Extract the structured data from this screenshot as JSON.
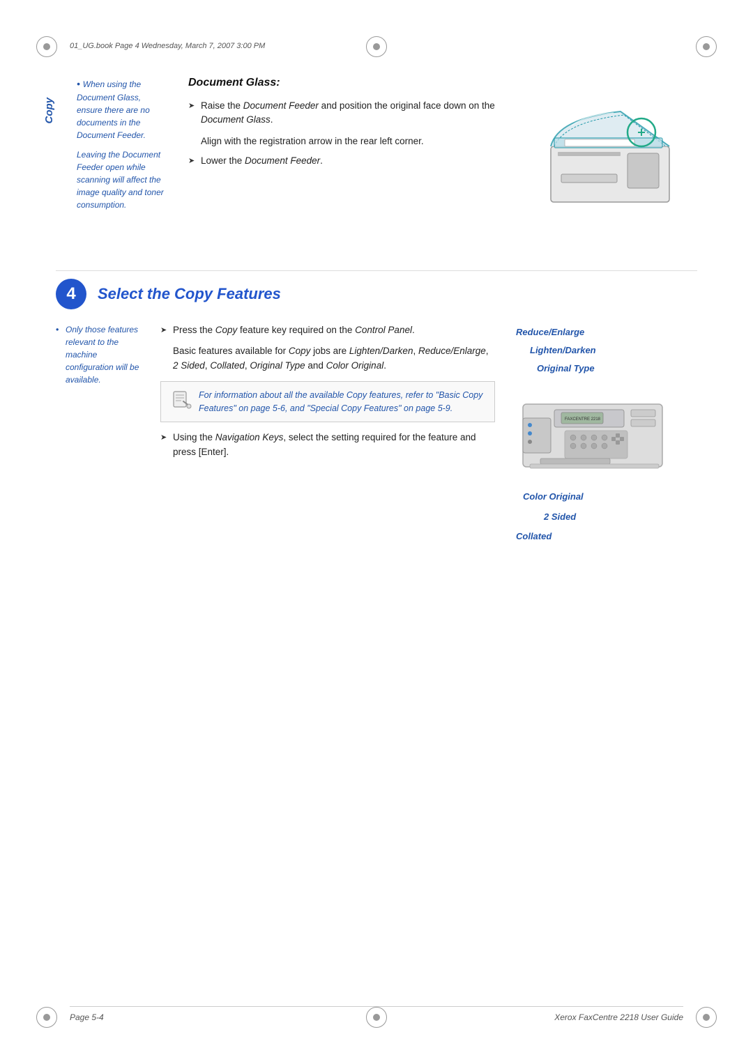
{
  "page_header": {
    "file_info": "01_UG.book  Page 4  Wednesday, March 7, 2007  3:00 PM"
  },
  "copy_label": "Copy",
  "document_glass": {
    "title": "Document Glass:",
    "bullet_note": "When using the Document Glass, ensure there are no documents in the Document Feeder.",
    "italic_note": "Leaving the Document Feeder open while scanning will affect the image quality and toner consumption.",
    "instructions": [
      {
        "arrow": "Raise the Document Feeder and position the original face down on the Document Glass.",
        "sub": "Align with the registration arrow in the rear left corner."
      },
      {
        "arrow": "Lower the Document Feeder.",
        "sub": ""
      }
    ]
  },
  "step4": {
    "number": "4",
    "title": "Select the Copy Features",
    "margin_note": "Only those features relevant to the machine configuration will be available.",
    "instructions": [
      {
        "arrow": "Press the Copy feature key required on the Control Panel.",
        "sub": "Basic features available for Copy jobs are Lighten/Darken, Reduce/Enlarge, 2 Sided, Collated, Original Type and Color Original."
      }
    ],
    "note_box": "For information about all the available Copy features, refer to \"Basic Copy Features\" on page 5-6, and \"Special Copy Features\" on page 5-9.",
    "instruction2": {
      "arrow": "Using the Navigation Keys, select the setting required for the feature and press [Enter]."
    },
    "right_labels": [
      "Reduce/Enlarge",
      "Lighten/Darken",
      "Original Type"
    ],
    "below_labels": [
      "Color Original",
      "2 Sided",
      "Collated"
    ]
  },
  "footer": {
    "left": "Page 5-4",
    "right": "Xerox FaxCentre 2218 User Guide"
  }
}
